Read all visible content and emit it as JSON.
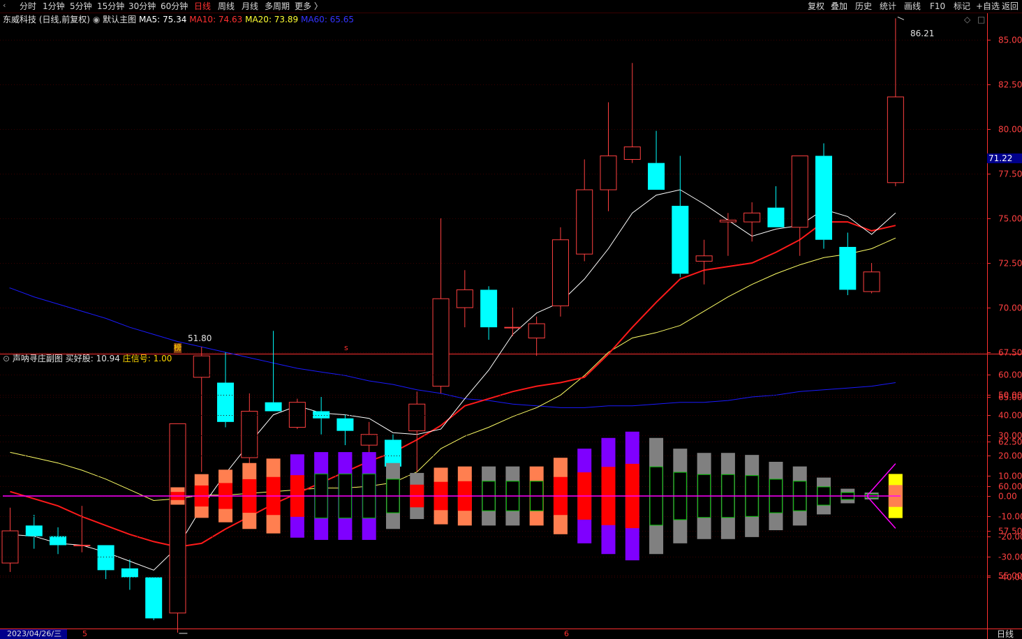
{
  "toolbar": {
    "left_items": [
      {
        "label": "分时"
      },
      {
        "label": "1分钟"
      },
      {
        "label": "5分钟"
      },
      {
        "label": "15分钟"
      },
      {
        "label": "30分钟"
      },
      {
        "label": "60分钟"
      },
      {
        "label": "日线",
        "active": true
      },
      {
        "label": "周线"
      },
      {
        "label": "月线"
      },
      {
        "label": "多周期"
      },
      {
        "label": "更多 〉"
      }
    ],
    "right_items": [
      {
        "label": "复权"
      },
      {
        "label": "叠加"
      },
      {
        "label": "历史"
      },
      {
        "label": "统计"
      },
      {
        "label": "画线"
      },
      {
        "label": "F10"
      },
      {
        "label": "标记"
      },
      {
        "label": "+自选"
      },
      {
        "label": "返回"
      }
    ]
  },
  "main": {
    "stock_title": "东威科技 (日线,前复权)",
    "chart_name": "默认主图",
    "ma5": "MA5: 75.34",
    "ma10": "MA10: 74.63",
    "ma20": "MA20: 73.89",
    "ma60": "MA60: 65.65",
    "high_label": "86.21",
    "low_label": "51.80",
    "current_price": "71.22",
    "marker_bang": "榜",
    "marker_s": "s"
  },
  "sub": {
    "indicator_name": "声呐寻庄副图",
    "buy_signal": "买好股: 10.94",
    "zhuang_signal": "庄信号: 1.00"
  },
  "status": {
    "date": "2023/04/26/三",
    "month5": "5",
    "month6": "6",
    "period": "日线"
  },
  "colors": {
    "up": "#ff4040",
    "down": "#00ffff",
    "ma5": "#ffffff",
    "ma10": "#ff1a1a",
    "ma20": "#ffff66",
    "ma60": "#1a1aff",
    "axis": "#ff3030",
    "red_bar": "#ff0000",
    "orange_bar": "#ff7f50",
    "purple_bar": "#7f00ff",
    "gray_bar": "#808080",
    "zero_line": "#ff00ff",
    "yellow_bar": "#ffff00"
  },
  "chart_data": [
    {
      "type": "candlestick",
      "title": "东威科技 (日线,前复权)",
      "y_ticks": [
        85.0,
        82.5,
        80.0,
        77.5,
        75.0,
        72.5,
        70.0,
        67.5,
        65.0,
        62.5,
        60.0,
        57.5,
        55.0
      ],
      "ylim": [
        50.0,
        87.5
      ],
      "candles": [
        {
          "o": 55.7,
          "h": 58.8,
          "l": 55.2,
          "c": 57.5
        },
        {
          "o": 57.8,
          "h": 58.4,
          "l": 56.5,
          "c": 57.2
        },
        {
          "o": 57.2,
          "h": 57.7,
          "l": 56.2,
          "c": 56.7
        },
        {
          "o": 56.7,
          "h": 58.9,
          "l": 56.3,
          "c": 56.7
        },
        {
          "o": 56.7,
          "h": 56.7,
          "l": 54.8,
          "c": 55.3
        },
        {
          "o": 55.4,
          "h": 55.9,
          "l": 54.2,
          "c": 54.9
        },
        {
          "o": 54.9,
          "h": 54.9,
          "l": 52.5,
          "c": 52.6
        },
        {
          "o": 52.9,
          "h": 63.5,
          "l": 51.8,
          "c": 63.5
        },
        {
          "o": 66.1,
          "h": 67.8,
          "l": 60.8,
          "c": 67.3
        },
        {
          "o": 65.8,
          "h": 67.5,
          "l": 63.3,
          "c": 63.6
        },
        {
          "o": 61.6,
          "h": 65.2,
          "l": 61.1,
          "c": 64.2
        },
        {
          "o": 64.7,
          "h": 68.7,
          "l": 64.2,
          "c": 64.2
        },
        {
          "o": 63.3,
          "h": 64.9,
          "l": 63.2,
          "c": 64.7
        },
        {
          "o": 64.2,
          "h": 65.0,
          "l": 62.9,
          "c": 63.8
        },
        {
          "o": 63.8,
          "h": 64.0,
          "l": 62.3,
          "c": 63.1
        },
        {
          "o": 62.3,
          "h": 63.6,
          "l": 61.5,
          "c": 62.9
        },
        {
          "o": 62.6,
          "h": 62.9,
          "l": 60.8,
          "c": 61.1
        },
        {
          "o": 63.1,
          "h": 65.3,
          "l": 60.8,
          "c": 64.6
        },
        {
          "o": 65.6,
          "h": 75.0,
          "l": 65.2,
          "c": 70.5
        },
        {
          "o": 70.0,
          "h": 72.1,
          "l": 68.9,
          "c": 71.0
        },
        {
          "o": 71.0,
          "h": 71.2,
          "l": 68.2,
          "c": 68.9
        },
        {
          "o": 68.9,
          "h": 70.0,
          "l": 68.4,
          "c": 68.9
        },
        {
          "o": 68.3,
          "h": 69.5,
          "l": 67.3,
          "c": 69.1
        },
        {
          "o": 70.1,
          "h": 74.5,
          "l": 69.5,
          "c": 73.8
        },
        {
          "o": 73.0,
          "h": 78.3,
          "l": 72.6,
          "c": 76.6
        },
        {
          "o": 76.6,
          "h": 81.5,
          "l": 75.4,
          "c": 78.5
        },
        {
          "o": 78.3,
          "h": 83.7,
          "l": 78.1,
          "c": 79.0
        },
        {
          "o": 78.1,
          "h": 79.9,
          "l": 76.6,
          "c": 76.6
        },
        {
          "o": 75.7,
          "h": 78.5,
          "l": 71.7,
          "c": 71.9
        },
        {
          "o": 72.6,
          "h": 73.8,
          "l": 71.3,
          "c": 72.9
        },
        {
          "o": 74.8,
          "h": 75.3,
          "l": 72.9,
          "c": 74.9
        },
        {
          "o": 74.8,
          "h": 75.9,
          "l": 73.7,
          "c": 75.3
        },
        {
          "o": 75.6,
          "h": 76.8,
          "l": 74.5,
          "c": 74.5
        },
        {
          "o": 74.5,
          "h": 78.5,
          "l": 72.9,
          "c": 78.5
        },
        {
          "o": 78.5,
          "h": 79.2,
          "l": 73.3,
          "c": 73.8
        },
        {
          "o": 73.4,
          "h": 74.2,
          "l": 70.7,
          "c": 71.0
        },
        {
          "o": 70.9,
          "h": 72.5,
          "l": 70.8,
          "c": 72.0
        },
        {
          "o": 77.0,
          "h": 86.2,
          "l": 76.8,
          "c": 81.8
        }
      ],
      "series": [
        {
          "name": "MA5",
          "values": [
            57.3,
            57.2,
            56.8,
            56.7,
            56.3,
            55.8,
            55.3,
            56.6,
            58.8,
            60.7,
            62.4,
            64.0,
            64.5,
            64.1,
            64.0,
            63.8,
            63.0,
            62.9,
            63.2,
            64.9,
            66.5,
            68.5,
            69.7,
            70.3,
            71.6,
            73.3,
            75.3,
            76.3,
            76.6,
            75.8,
            74.9,
            74.0,
            74.4,
            74.6,
            75.5,
            75.1,
            74.1,
            75.3
          ]
        },
        {
          "name": "MA10",
          "values": [
            59.7,
            59.3,
            58.9,
            58.3,
            57.8,
            57.3,
            56.9,
            56.6,
            56.8,
            57.6,
            58.3,
            59.0,
            59.6,
            60.2,
            60.8,
            61.4,
            61.9,
            62.6,
            63.4,
            64.5,
            64.9,
            65.3,
            65.6,
            65.8,
            66.1,
            67.4,
            68.9,
            70.3,
            71.6,
            72.1,
            72.3,
            72.5,
            73.1,
            73.8,
            74.8,
            74.8,
            74.3,
            74.6
          ]
        },
        {
          "name": "MA20",
          "values": [
            61.9,
            61.6,
            61.3,
            60.9,
            60.4,
            59.8,
            59.2,
            59.3,
            59.5,
            59.5,
            59.6,
            59.7,
            59.8,
            59.9,
            59.9,
            60.0,
            60.2,
            60.8,
            62.1,
            62.8,
            63.3,
            63.9,
            64.4,
            65.1,
            66.2,
            67.5,
            68.3,
            68.6,
            69.0,
            69.8,
            70.6,
            71.3,
            71.9,
            72.4,
            72.8,
            73.0,
            73.3,
            73.9
          ]
        },
        {
          "name": "MA60",
          "values": [
            71.1,
            70.6,
            70.2,
            69.8,
            69.4,
            68.9,
            68.5,
            68.1,
            67.8,
            67.5,
            67.2,
            66.9,
            66.6,
            66.4,
            66.2,
            65.9,
            65.7,
            65.4,
            65.2,
            64.9,
            64.8,
            64.6,
            64.5,
            64.4,
            64.4,
            64.5,
            64.5,
            64.6,
            64.7,
            64.7,
            64.8,
            65.0,
            65.1,
            65.3,
            65.4,
            65.5,
            65.6,
            65.8
          ]
        }
      ]
    },
    {
      "type": "bar",
      "title": "声呐寻庄副图",
      "y_ticks": [
        60.0,
        50.0,
        40.0,
        30.0,
        20.0,
        10.0,
        0.0,
        -10.0,
        -20.0,
        -30.0,
        -40.0
      ],
      "ylim": [
        -60,
        65
      ],
      "bars": [
        {
          "i": 7,
          "outer": 4.3,
          "outer_color": "orange",
          "inner": 2.0,
          "inner_color": "red"
        },
        {
          "i": 8,
          "outer": 10.8,
          "outer_color": "orange",
          "inner": 5.2,
          "inner_color": "red"
        },
        {
          "i": 9,
          "outer": 13.0,
          "outer_color": "orange",
          "inner": 6.4,
          "inner_color": "red"
        },
        {
          "i": 10,
          "outer": 16.3,
          "outer_color": "orange",
          "inner": 8.3,
          "inner_color": "red"
        },
        {
          "i": 11,
          "outer": 18.5,
          "outer_color": "orange",
          "inner": 9.4,
          "inner_color": "red"
        },
        {
          "i": 12,
          "outer": 20.6,
          "outer_color": "purple",
          "inner": 10.3,
          "inner_color": "red"
        },
        {
          "i": 13,
          "outer": 21.7,
          "outer_color": "purple",
          "inner": 10.9,
          "inner_color": "outline"
        },
        {
          "i": 14,
          "outer": 21.7,
          "outer_color": "purple",
          "inner": 10.9,
          "inner_color": "outline"
        },
        {
          "i": 15,
          "outer": 21.7,
          "outer_color": "purple",
          "inner": 10.9,
          "inner_color": "outline"
        },
        {
          "i": 16,
          "outer": 16.3,
          "outer_color": "gray",
          "inner": 8.3,
          "inner_color": "outline"
        },
        {
          "i": 17,
          "outer": 11.4,
          "outer_color": "gray",
          "inner": 5.6,
          "inner_color": "red"
        },
        {
          "i": 18,
          "outer": 14.0,
          "outer_color": "orange",
          "inner": 7.0,
          "inner_color": "red"
        },
        {
          "i": 19,
          "outer": 14.6,
          "outer_color": "orange",
          "inner": 7.3,
          "inner_color": "red"
        },
        {
          "i": 20,
          "outer": 14.6,
          "outer_color": "gray",
          "inner": 7.3,
          "inner_color": "outline"
        },
        {
          "i": 21,
          "outer": 14.6,
          "outer_color": "gray",
          "inner": 7.3,
          "inner_color": "outline"
        },
        {
          "i": 22,
          "outer": 14.6,
          "outer_color": "orange",
          "inner": 7.3,
          "inner_color": "outline"
        },
        {
          "i": 23,
          "outer": 18.9,
          "outer_color": "orange",
          "inner": 9.4,
          "inner_color": "red"
        },
        {
          "i": 24,
          "outer": 23.4,
          "outer_color": "purple",
          "inner": 11.7,
          "inner_color": "red"
        },
        {
          "i": 25,
          "outer": 28.7,
          "outer_color": "purple",
          "inner": 14.4,
          "inner_color": "red"
        },
        {
          "i": 26,
          "outer": 31.8,
          "outer_color": "purple",
          "inner": 15.9,
          "inner_color": "red"
        },
        {
          "i": 27,
          "outer": 28.7,
          "outer_color": "gray",
          "inner": 14.4,
          "inner_color": "outline"
        },
        {
          "i": 28,
          "outer": 23.4,
          "outer_color": "gray",
          "inner": 11.7,
          "inner_color": "outline"
        },
        {
          "i": 29,
          "outer": 21.3,
          "outer_color": "gray",
          "inner": 10.6,
          "inner_color": "outline"
        },
        {
          "i": 30,
          "outer": 21.3,
          "outer_color": "gray",
          "inner": 10.6,
          "inner_color": "outline"
        },
        {
          "i": 31,
          "outer": 20.3,
          "outer_color": "gray",
          "inner": 10.1,
          "inner_color": "outline"
        },
        {
          "i": 32,
          "outer": 16.9,
          "outer_color": "gray",
          "inner": 8.3,
          "inner_color": "outline"
        },
        {
          "i": 33,
          "outer": 14.6,
          "outer_color": "gray",
          "inner": 7.3,
          "inner_color": "outline"
        },
        {
          "i": 34,
          "outer": 9.1,
          "outer_color": "gray",
          "inner": 4.5,
          "inner_color": "outline"
        },
        {
          "i": 35,
          "outer": 3.6,
          "outer_color": "gray",
          "inner": 1.7,
          "inner_color": "outline"
        },
        {
          "i": 36,
          "outer": 1.7,
          "outer_color": "gray",
          "inner": 0.8,
          "inner_color": "outline"
        },
        {
          "i": 37,
          "outer": 10.9,
          "outer_color": "yellow",
          "inner": 5.4,
          "inner_color": "orange"
        }
      ],
      "funnel": {
        "i": 37,
        "top": 16.0,
        "bottom": -16.0,
        "start_i": 35.8
      }
    }
  ]
}
